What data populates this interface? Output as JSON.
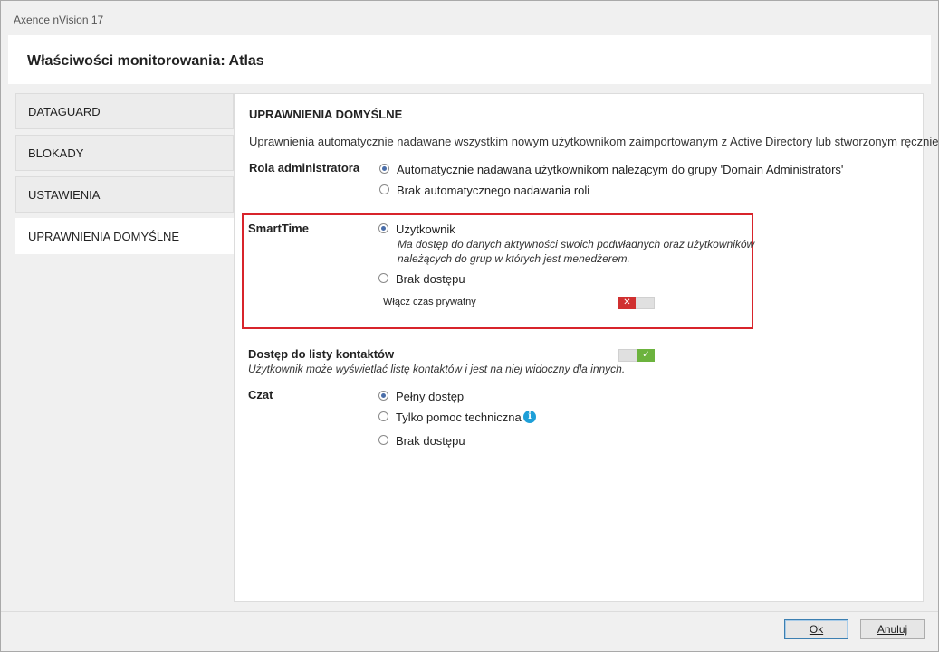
{
  "window": {
    "app_title": "Axence nVision 17"
  },
  "header": {
    "title": "Właściwości monitorowania: Atlas"
  },
  "sidebar": {
    "items": [
      {
        "label": "DATAGUARD"
      },
      {
        "label": "BLOKADY"
      },
      {
        "label": "USTAWIENIA"
      },
      {
        "label": "UPRAWNIENIA DOMYŚLNE",
        "active": true
      }
    ]
  },
  "content": {
    "section_title": "UPRAWNIENIA DOMYŚLNE",
    "description": "Uprawnienia automatycznie nadawane wszystkim nowym użytkownikom zaimportowanym z Active Directory lub stworzonym ręcznie.",
    "admin_role": {
      "label": "Rola administratora",
      "options": [
        {
          "label": "Automatycznie nadawana użytkownikom należącym do grupy 'Domain Administrators'",
          "checked": true
        },
        {
          "label": "Brak automatycznego nadawania roli",
          "checked": false
        }
      ]
    },
    "smarttime": {
      "label": "SmartTime",
      "options": [
        {
          "label": "Użytkownik",
          "checked": true,
          "desc_line1": "Ma dostęp do danych aktywności swoich podwładnych oraz użytkowników",
          "desc_line2": "należących do grup w których jest menedżerem."
        },
        {
          "label": "Brak dostępu",
          "checked": false
        }
      ],
      "private_time_label": "Włącz czas prywatny",
      "private_time_enabled": false,
      "toggle_off_glyph": "✕"
    },
    "contacts": {
      "label": "Dostęp do listy kontaktów",
      "desc": "Użytkownik może wyświetlać listę kontaktów i jest na niej widoczny dla innych.",
      "enabled": true,
      "toggle_on_glyph": "✓"
    },
    "chat": {
      "label": "Czat",
      "options": [
        {
          "label": "Pełny dostęp",
          "checked": true
        },
        {
          "label": "Tylko pomoc techniczna",
          "checked": false
        },
        {
          "label": "Brak dostępu",
          "checked": false
        }
      ],
      "info_glyph": "i"
    }
  },
  "footer": {
    "ok_label": "Ok",
    "cancel_label": "Anuluj"
  },
  "colors": {
    "highlight_border": "#d8242b",
    "toggle_off": "#d03030",
    "toggle_on": "#6cb33e",
    "info": "#1e9fd8"
  }
}
